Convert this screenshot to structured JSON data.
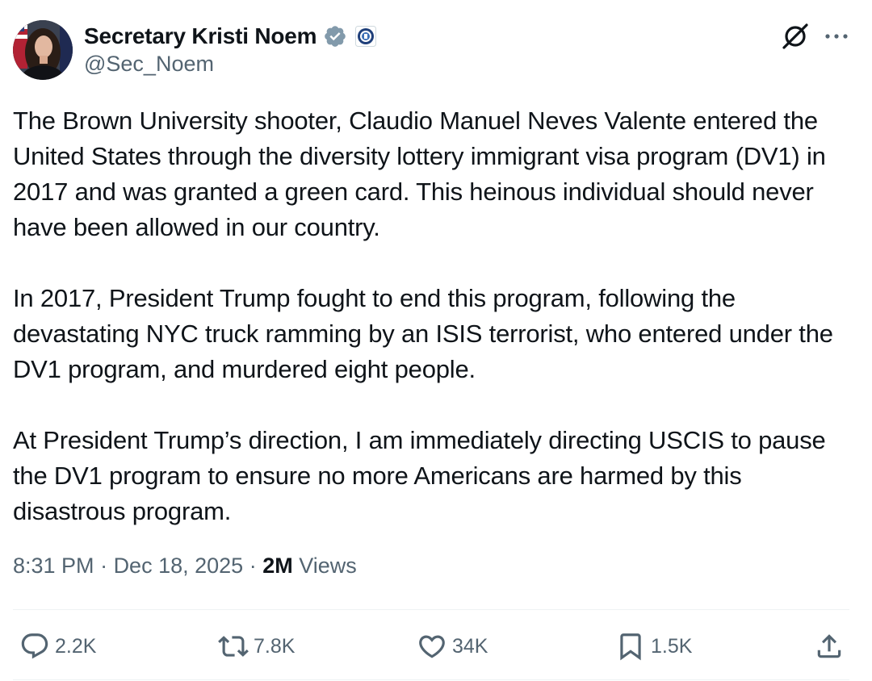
{
  "author": {
    "display_name": "Secretary Kristi Noem",
    "handle": "@Sec_Noem",
    "verified_badge": "verified-badge-icon",
    "affiliation_badge": "dhs-seal-icon",
    "colors": {
      "verified": "#829aab",
      "text": "#0f1419",
      "muted": "#536471"
    }
  },
  "header_actions": {
    "grok": "grok-icon",
    "more": "more-icon"
  },
  "tweet": {
    "paragraphs": [
      "The Brown University shooter, Claudio Manuel Neves Valente entered the United States through the diversity lottery immigrant visa program (DV1) in 2017 and was granted a green card. This heinous individual should never have been allowed in our country.",
      "In 2017, President Trump fought to end this program, following the devastating NYC truck ramming by an ISIS terrorist, who entered under the DV1 program, and murdered eight people.",
      "At President Trump’s direction, I am immediately directing USCIS to pause the DV1 program to ensure no more Americans are harmed by this disastrous program."
    ]
  },
  "meta": {
    "time": "8:31 PM",
    "separator": " · ",
    "date": "Dec 18, 2025",
    "views_count": "2M",
    "views_label": " Views"
  },
  "actions": {
    "replies": "2.2K",
    "reposts": "7.8K",
    "likes": "34K",
    "bookmarks": "1.5K"
  }
}
